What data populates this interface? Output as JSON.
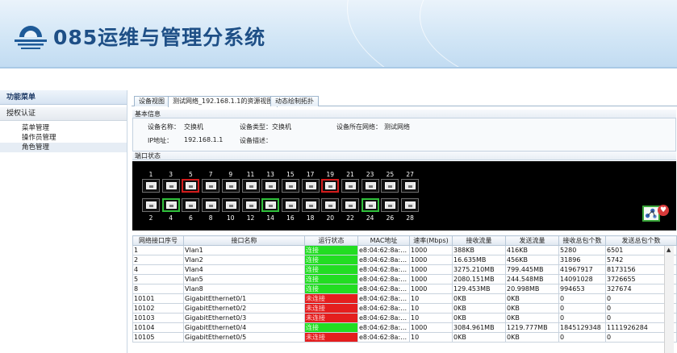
{
  "header": {
    "title": "085运维与管理分系统"
  },
  "sidebar": {
    "heading": "功能菜单",
    "group": "授权认证",
    "items": [
      {
        "label": "菜单管理"
      },
      {
        "label": "操作员管理"
      },
      {
        "label": "角色管理"
      }
    ]
  },
  "tabs": [
    {
      "label": "设备视图"
    },
    {
      "label": "测试网络_192.168.1.1的资源视图"
    },
    {
      "label": "动态绘制拓扑"
    }
  ],
  "basic_info": {
    "title": "基本信息",
    "device_name_label": "设备名称：",
    "device_name": "交换机",
    "device_type_label": "设备类型：",
    "device_type": "交换机",
    "network_label": "设备所在网络：",
    "network": "测试网络",
    "ip_label": "IP地址：",
    "ip": "192.168.1.1",
    "desc_label": "设备描述："
  },
  "port_status": {
    "title": "端口状态",
    "top_numbers": [
      "1",
      "3",
      "5",
      "7",
      "9",
      "11",
      "13",
      "15",
      "17",
      "19",
      "21",
      "23",
      "25",
      "27"
    ],
    "bottom_numbers": [
      "2",
      "4",
      "6",
      "8",
      "10",
      "12",
      "14",
      "16",
      "18",
      "20",
      "22",
      "24",
      "26",
      "28"
    ],
    "top_highlight": [
      "none",
      "none",
      "red",
      "none",
      "none",
      "none",
      "none",
      "none",
      "none",
      "red",
      "none",
      "none",
      "none",
      "none"
    ],
    "bottom_highlight": [
      "none",
      "green",
      "none",
      "none",
      "none",
      "none",
      "green",
      "none",
      "none",
      "none",
      "none",
      "green",
      "none",
      "none"
    ]
  },
  "table": {
    "columns": [
      "网络接口序号",
      "接口名称",
      "运行状态",
      "MAC地址",
      "速率(Mbps)",
      "接收流量",
      "发送流量",
      "接收总包个数",
      "发送总包个数"
    ],
    "rows": [
      [
        "1",
        "Vlan1",
        "连接",
        "e8:04:62:8a:0c...",
        "1000",
        "388KB",
        "416KB",
        "5280",
        "6501"
      ],
      [
        "2",
        "Vlan2",
        "连接",
        "e8:04:62:8a:0c...",
        "1000",
        "16.635MB",
        "456KB",
        "31896",
        "5742"
      ],
      [
        "4",
        "Vlan4",
        "连接",
        "e8:04:62:8a:0c...",
        "1000",
        "3275.210MB",
        "799.445MB",
        "41967917",
        "8173156"
      ],
      [
        "5",
        "Vlan5",
        "连接",
        "e8:04:62:8a:0c...",
        "1000",
        "2080.151MB",
        "244.548MB",
        "14091028",
        "3726655"
      ],
      [
        "8",
        "Vlan8",
        "连接",
        "e8:04:62:8a:0c...",
        "1000",
        "129.453MB",
        "20.998MB",
        "994653",
        "327674"
      ],
      [
        "10101",
        "GigabitEthernet0/1",
        "未连接",
        "e8:04:62:8a:0c...",
        "10",
        "0KB",
        "0KB",
        "0",
        "0"
      ],
      [
        "10102",
        "GigabitEthernet0/2",
        "未连接",
        "e8:04:62:8a:0c...",
        "10",
        "0KB",
        "0KB",
        "0",
        "0"
      ],
      [
        "10103",
        "GigabitEthernet0/3",
        "未连接",
        "e8:04:62:8a:0c...",
        "10",
        "0KB",
        "0KB",
        "0",
        "0"
      ],
      [
        "10104",
        "GigabitEthernet0/4",
        "连接",
        "e8:04:62:8a:0c...",
        "1000",
        "3084.961MB",
        "1219.777MB",
        "1845129348",
        "1111926284"
      ],
      [
        "10105",
        "GigabitEthernet0/5",
        "未连接",
        "e8:04:62:8a:0c...",
        "10",
        "0KB",
        "0KB",
        "0",
        "0"
      ]
    ]
  },
  "colors": {
    "status_up": "#22dd22",
    "status_down": "#e41e1e",
    "title": "#1e4f86"
  },
  "icons": {
    "logo": "sailboat-logo-icon",
    "topology": "topology-icon",
    "favorite": "heart-badge-icon",
    "scroll": "scroll-up-arrow-icon"
  }
}
